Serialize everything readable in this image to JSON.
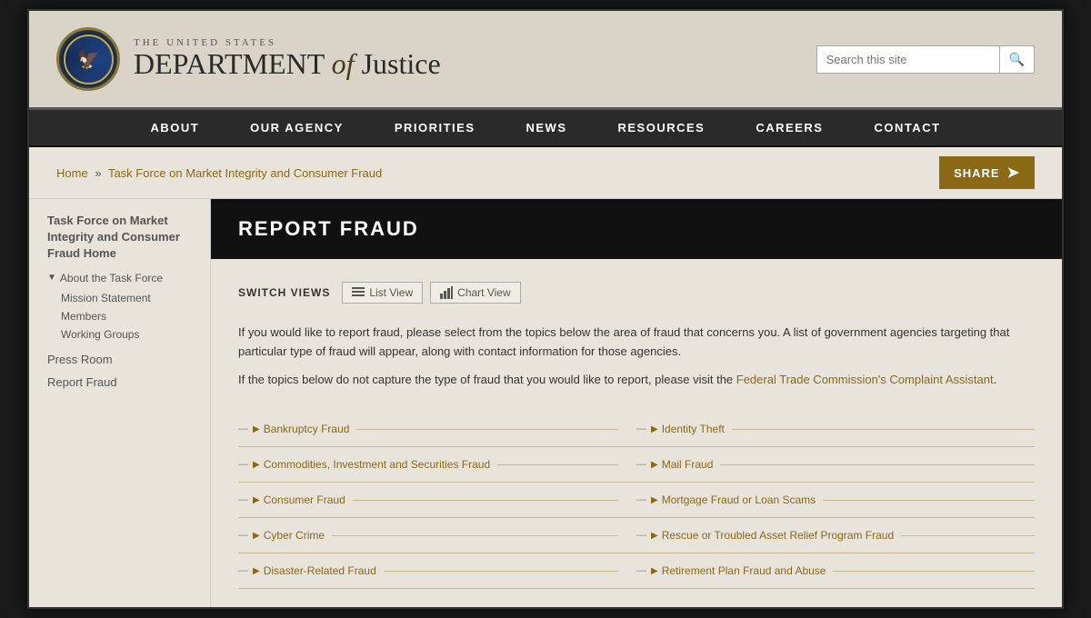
{
  "header": {
    "seal_label": "Department of Justice Seal",
    "title_top": "THE UNITED STATES",
    "title_main_prefix": "DEPARTMENT",
    "title_main_of": "of",
    "title_main_suffix": "Justice",
    "search_placeholder": "Search this site"
  },
  "nav": {
    "items": [
      {
        "label": "ABOUT",
        "id": "about"
      },
      {
        "label": "OUR AGENCY",
        "id": "our-agency"
      },
      {
        "label": "PRIORITIES",
        "id": "priorities"
      },
      {
        "label": "NEWS",
        "id": "news"
      },
      {
        "label": "RESOURCES",
        "id": "resources"
      },
      {
        "label": "CAREERS",
        "id": "careers"
      },
      {
        "label": "CONTACT",
        "id": "contact"
      }
    ]
  },
  "breadcrumb": {
    "home": "Home",
    "separator": "»",
    "current": "Task Force on Market Integrity and Consumer Fraud",
    "share_label": "SHARE"
  },
  "sidebar": {
    "task_force_title": "Task Force on Market Integrity and Consumer Fraud Home",
    "about_section": "About the Task Force",
    "sub_items": [
      {
        "label": "Mission Statement"
      },
      {
        "label": "Members"
      },
      {
        "label": "Working Groups"
      }
    ],
    "links": [
      {
        "label": "Press Room"
      },
      {
        "label": "Report Fraud"
      }
    ]
  },
  "content": {
    "banner": "REPORT FRAUD",
    "switch_views_label": "SWITCH VIEWS",
    "list_view_label": "List View",
    "chart_view_label": "Chart View",
    "intro_para1": "If you would like to report fraud, please select from the topics below the area of fraud that concerns you.  A list of government agencies targeting that particular type of fraud will appear, along with contact information for those agencies.",
    "intro_para2_prefix": "If the topics below do not capture the type of fraud that you would like to report, please visit the ",
    "ftc_link": "Federal Trade Commission's Complaint Assistant",
    "intro_para2_suffix": ".",
    "fraud_items_left": [
      {
        "label": "Bankruptcy Fraud"
      },
      {
        "label": "Commodities, Investment and Securities Fraud"
      },
      {
        "label": "Consumer Fraud"
      },
      {
        "label": "Cyber Crime"
      },
      {
        "label": "Disaster-Related Fraud"
      }
    ],
    "fraud_items_right": [
      {
        "label": "Identity Theft"
      },
      {
        "label": "Mail Fraud"
      },
      {
        "label": "Mortgage Fraud or Loan Scams"
      },
      {
        "label": "Rescue or Troubled Asset Relief Program Fraud"
      },
      {
        "label": "Retirement Plan Fraud and Abuse"
      }
    ]
  }
}
